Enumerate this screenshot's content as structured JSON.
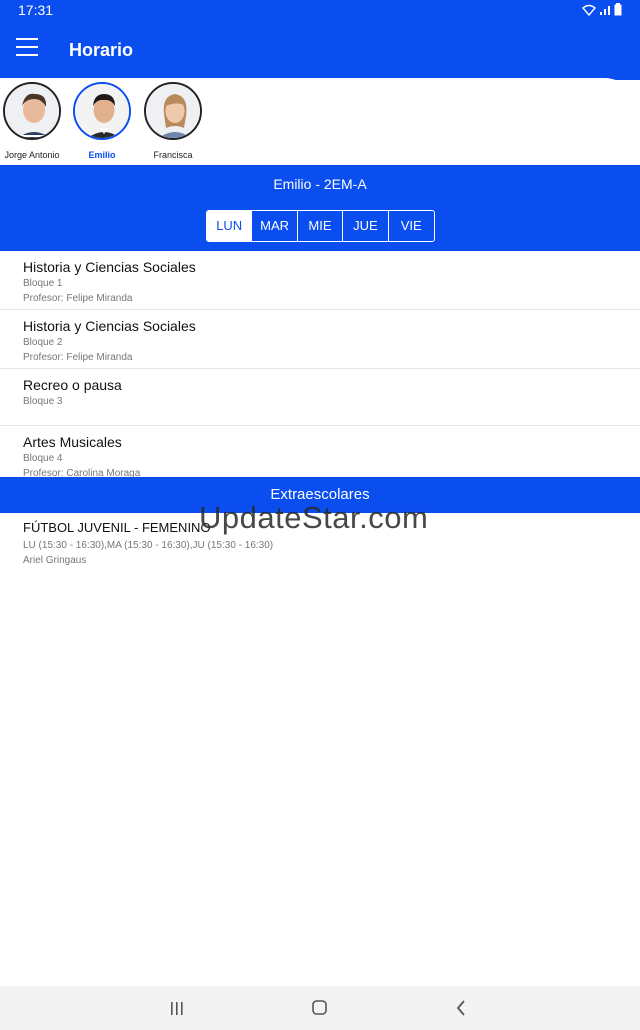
{
  "status_bar": {
    "time": "17:31"
  },
  "app_bar": {
    "title": "Horario"
  },
  "students": [
    {
      "name": "Jorge Antonio",
      "selected": false
    },
    {
      "name": "Emilio",
      "selected": true
    },
    {
      "name": "Francisca",
      "selected": false
    }
  ],
  "course": {
    "title": "Emilio - 2EM-A"
  },
  "days": [
    "LUN",
    "MAR",
    "MIE",
    "JUE",
    "VIE"
  ],
  "active_day": "LUN",
  "schedule": [
    {
      "subject": "Historia y Ciencias Sociales",
      "block": "Bloque 1",
      "teacher": "Profesor: Felipe Miranda"
    },
    {
      "subject": "Historia y Ciencias Sociales",
      "block": "Bloque 2",
      "teacher": "Profesor: Felipe Miranda"
    },
    {
      "subject": "Recreo o pausa",
      "block": "Bloque 3",
      "teacher": ""
    },
    {
      "subject": "Artes Musicales",
      "block": "Bloque 4",
      "teacher": "Profesor: Carolina Moraga"
    }
  ],
  "extracurricular": {
    "header": "Extraescolares",
    "items": [
      {
        "title": "FÚTBOL JUVENIL - FEMENINO",
        "schedule": "LU (15:30 - 16:30),MA (15:30 - 16:30),JU (15:30 - 16:30)",
        "teacher": "Ariel Gringaus"
      }
    ]
  },
  "watermark": "UpdateStar.com",
  "colors": {
    "primary": "#0a4ef0",
    "background": "#ffffff",
    "muted_text": "#777777"
  },
  "icons": [
    "hamburger-menu-icon",
    "wifi-icon",
    "signal-icon",
    "battery-icon",
    "recents-icon",
    "home-icon",
    "back-icon"
  ]
}
